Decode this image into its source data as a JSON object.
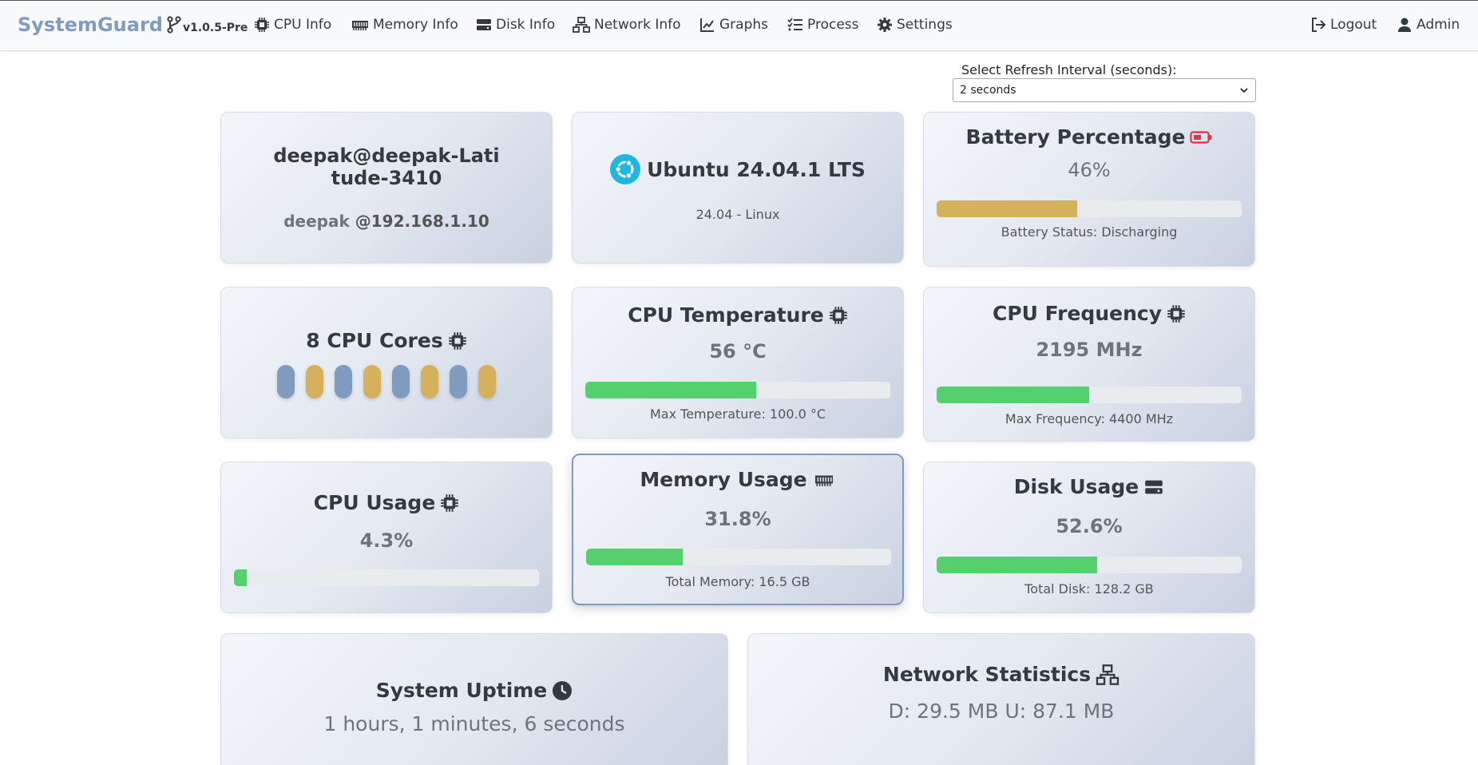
{
  "navbar": {
    "brand": "SystemGuard",
    "version": "v1.0.5-Pre",
    "items": [
      {
        "label": "CPU Info",
        "icon": "chip-icon"
      },
      {
        "label": "Memory Info",
        "icon": "memory-icon"
      },
      {
        "label": "Disk Info",
        "icon": "hdd-icon"
      },
      {
        "label": "Network Info",
        "icon": "network-icon"
      },
      {
        "label": "Graphs",
        "icon": "chart-line-icon"
      },
      {
        "label": "Process",
        "icon": "list-check-icon"
      },
      {
        "label": "Settings",
        "icon": "gear-icon"
      }
    ],
    "logout": "Logout",
    "user": "Admin"
  },
  "refresh": {
    "label": "Select Refresh Interval (seconds):",
    "selected": "2 seconds"
  },
  "host": {
    "hostname": "deepak@deepak-Latitude-3410",
    "user": "deepak",
    "ip": "@192.168.1.10"
  },
  "os": {
    "name": "Ubuntu 24.04.1 LTS",
    "detail": "24.04 - Linux"
  },
  "battery": {
    "title": "Battery Percentage",
    "value": "46%",
    "percent": 46,
    "status": "Battery Status: Discharging"
  },
  "cores": {
    "title": "8 CPU Cores",
    "count": 8
  },
  "cpu_temp": {
    "title": "CPU Temperature",
    "value": "56 °C",
    "percent": 56,
    "max": "Max Temperature: 100.0 °C"
  },
  "cpu_freq": {
    "title": "CPU Frequency",
    "value": "2195 MHz",
    "percent": 49.9,
    "max": "Max Frequency: 4400 MHz"
  },
  "cpu_usage": {
    "title": "CPU Usage",
    "value": "4.3%",
    "percent": 4.3
  },
  "memory": {
    "title": "Memory Usage",
    "value": "31.8%",
    "percent": 31.8,
    "total": "Total Memory: 16.5 GB"
  },
  "disk": {
    "title": "Disk Usage",
    "value": "52.6%",
    "percent": 52.6,
    "total": "Total Disk: 128.2 GB"
  },
  "uptime": {
    "title": "System Uptime",
    "value": "1 hours, 1 minutes, 6 seconds"
  },
  "network": {
    "title": "Network Statistics",
    "value": "D: 29.5 MB U: 87.1 MB"
  },
  "colors": {
    "brand": "#7f9cc0",
    "bar_green": "#55d06f",
    "bar_battery": "#d5b15c",
    "pill_blue": "#7f9cc0",
    "pill_gold": "#d5b15c",
    "battery_icon": "#dc3545",
    "ubuntu": "#1fb6e0"
  }
}
